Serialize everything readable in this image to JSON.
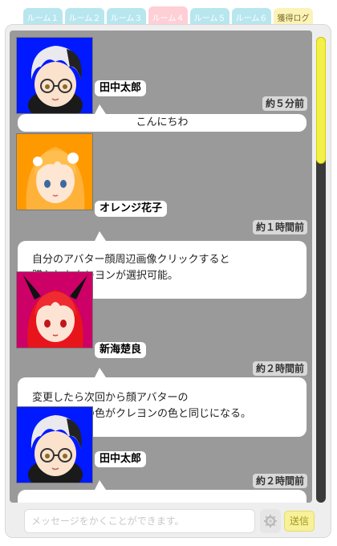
{
  "tabs": [
    {
      "label": "ルーム１",
      "active": false
    },
    {
      "label": "ルーム２",
      "active": false
    },
    {
      "label": "ルーム３",
      "active": false
    },
    {
      "label": "ルーム４",
      "active": true
    },
    {
      "label": "ルーム５",
      "active": false
    },
    {
      "label": "ルーム６",
      "active": false
    }
  ],
  "log_tab": {
    "label": "獲得ログ"
  },
  "messages": [
    {
      "name": "田中太郎",
      "time": "約５分前",
      "text": [
        "こんにちわ"
      ],
      "avatar": "silver-hair-glasses-boy",
      "avatar_bg": "#0019ff"
    },
    {
      "name": "オレンジ花子",
      "time": "約１時間前",
      "text": [
        "自分のアバター顔周辺画像クリックすると",
        "購入したクレヨンが選択可能。"
      ],
      "avatar": "orange-hair-girl",
      "avatar_bg": "#ff9900"
    },
    {
      "name": "新海楚良",
      "time": "約２時間前",
      "text": [
        "変更したら次回から顔アバターの",
        "後ろの背景の色がクレヨンの色と同じになる。"
      ],
      "avatar": "red-hair-horned-girl",
      "avatar_bg": "#cc0066"
    },
    {
      "name": "田中太郎",
      "time": "約２時間前",
      "text": [],
      "avatar": "silver-hair-glasses-boy",
      "avatar_bg": "#0019ff"
    }
  ],
  "input": {
    "placeholder": "メッセージをかくことができます。"
  },
  "send_button": {
    "label": "送信"
  },
  "colors": {
    "accent_tab": "#ffcfd6",
    "tab": "#b8e6ef",
    "scroll_thumb": "#f3f04a",
    "chat_bg": "#9a9a9a"
  },
  "icons": {
    "crayon_button": "gear-icon"
  }
}
